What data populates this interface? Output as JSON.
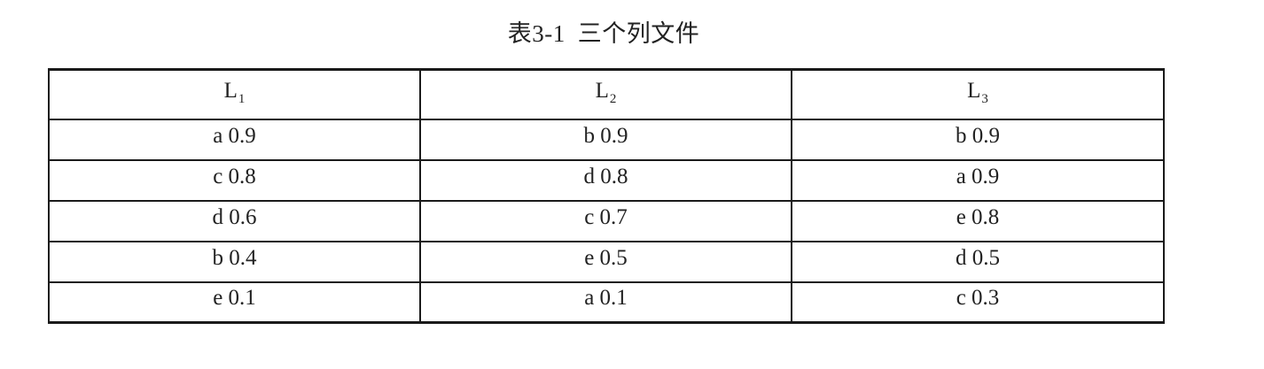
{
  "caption": {
    "label": "表3-1",
    "text": "三个列文件"
  },
  "table": {
    "headers": [
      {
        "base": "L",
        "sub": "1"
      },
      {
        "base": "L",
        "sub": "2"
      },
      {
        "base": "L",
        "sub": "3"
      }
    ],
    "rows": [
      [
        "a 0.9",
        "b 0.9",
        "b 0.9"
      ],
      [
        "c 0.8",
        "d 0.8",
        "a 0.9"
      ],
      [
        "d 0.6",
        "c 0.7",
        "e 0.8"
      ],
      [
        "b 0.4",
        "e 0.5",
        "d 0.5"
      ],
      [
        "e 0.1",
        "a 0.1",
        "c 0.3"
      ]
    ]
  }
}
